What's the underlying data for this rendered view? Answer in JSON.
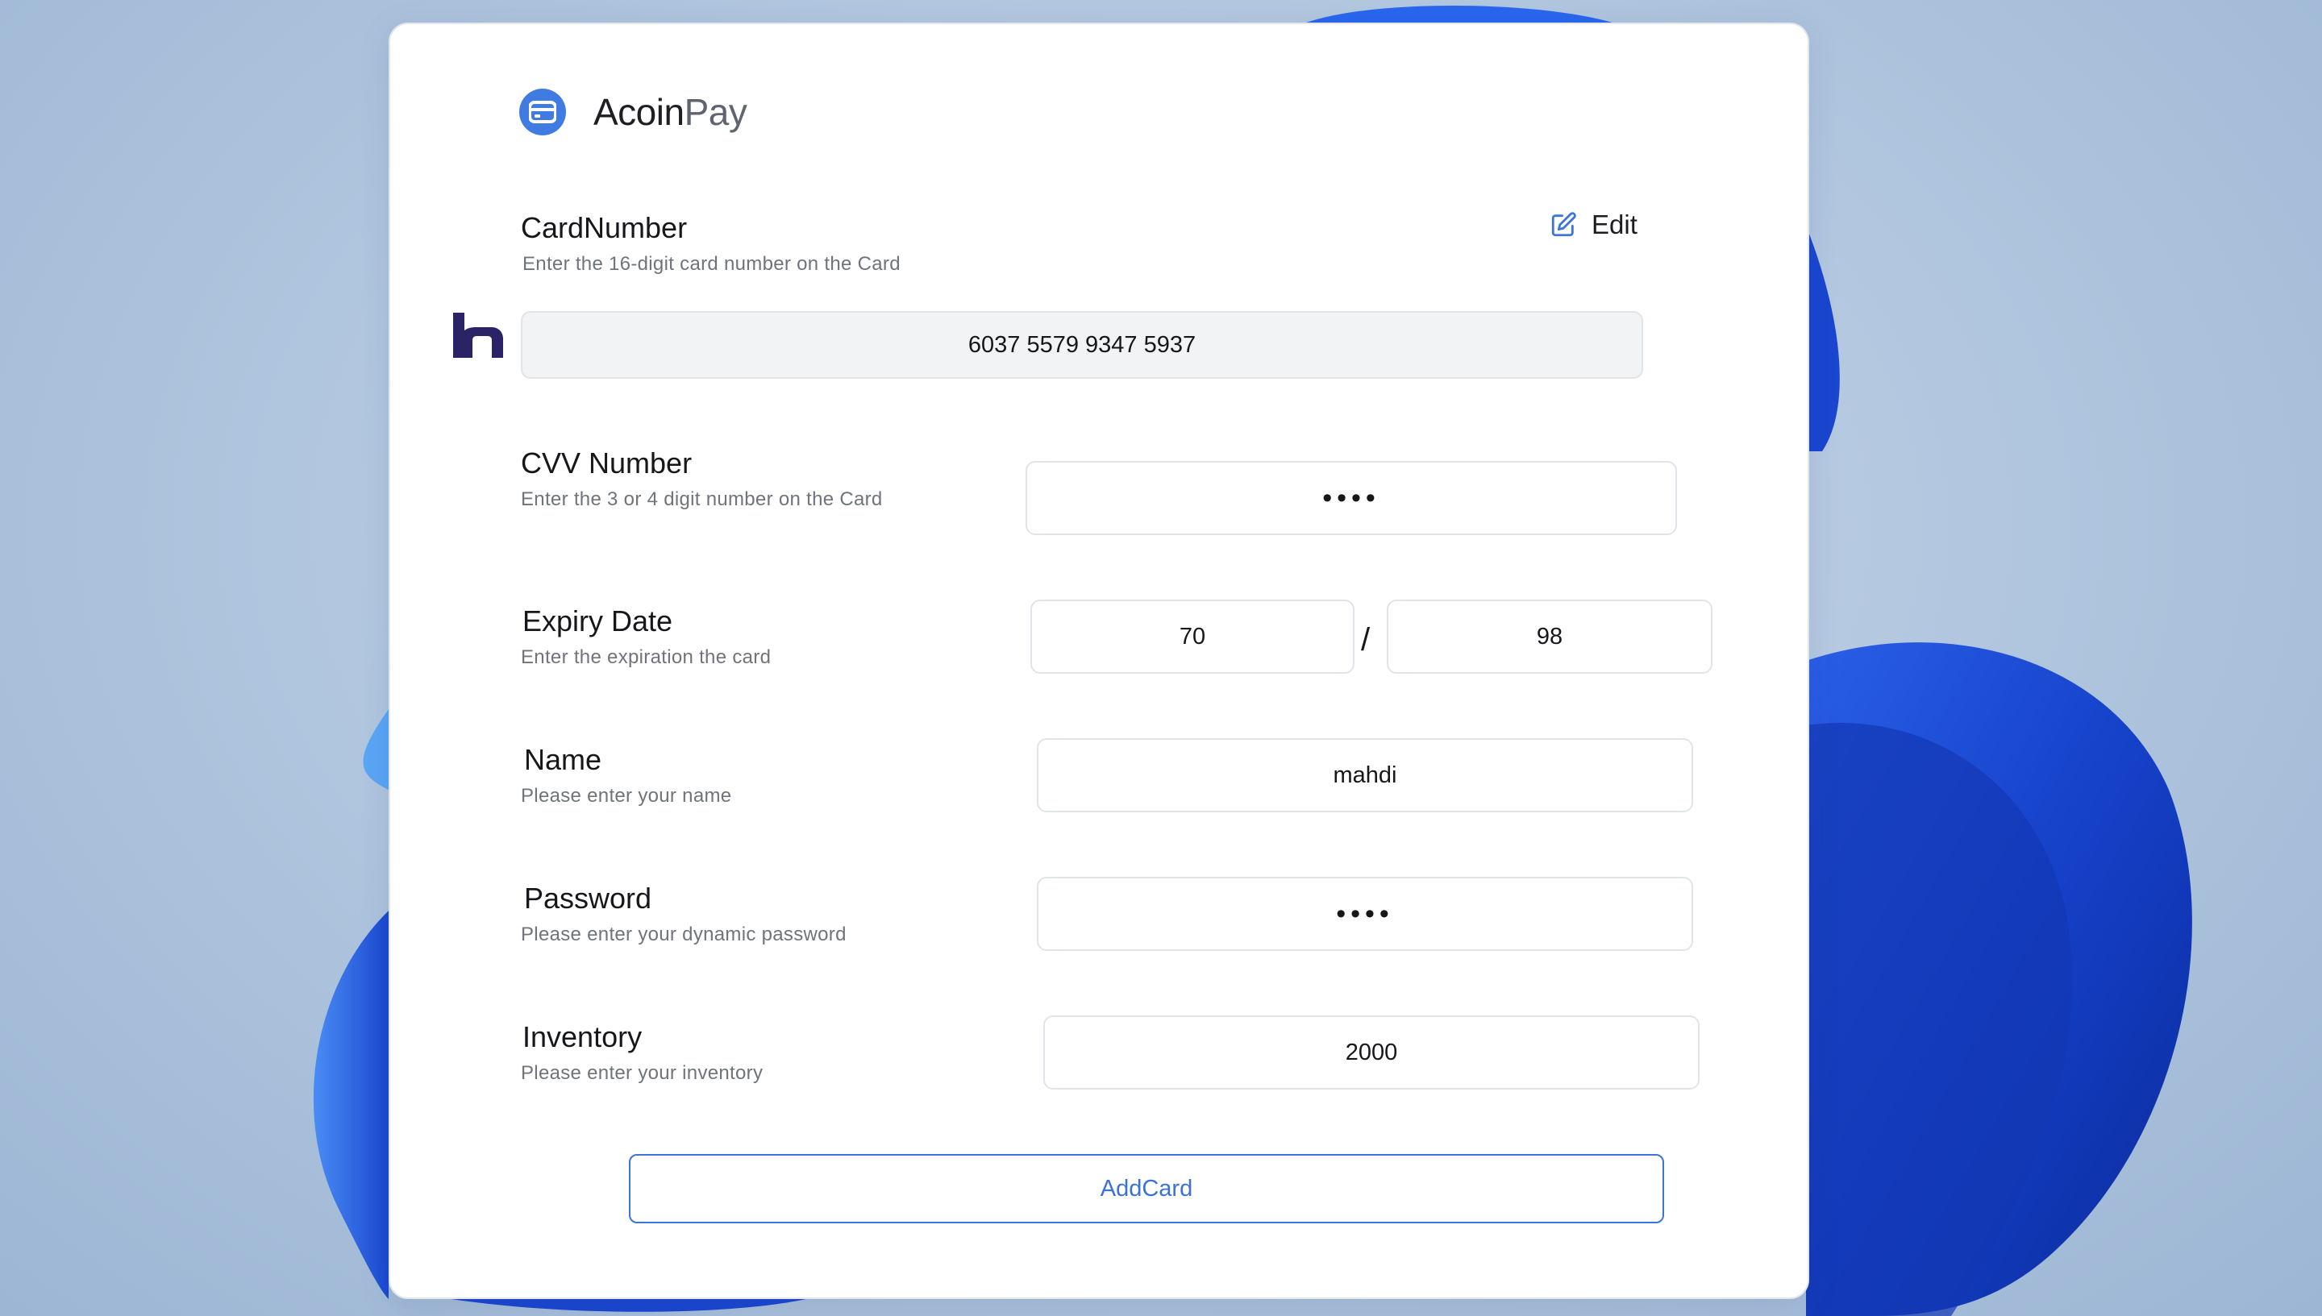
{
  "brand": {
    "name_part1": "Acoin",
    "name_part2": "Pay",
    "logo_icon": "credit-card-icon"
  },
  "card_number": {
    "title": "CardNumber",
    "hint": "Enter the 16-digit card number on the Card",
    "value": "6037 5579 9347 5937",
    "edit_label": "Edit",
    "bank_icon": "bank-logo-icon"
  },
  "cvv": {
    "title": "CVV Number",
    "hint": "Enter the 3 or 4 digit number on the Card",
    "value": "••••"
  },
  "expiry": {
    "title": "Expiry Date",
    "hint": "Enter the expiration the card",
    "month": "70",
    "separator": "/",
    "year": "98"
  },
  "name": {
    "title": "Name",
    "hint": "Please enter your name",
    "value": "mahdi"
  },
  "password": {
    "title": "Password",
    "hint": "Please enter your dynamic password",
    "value": "••••"
  },
  "inventory": {
    "title": "Inventory",
    "hint": "Please enter your inventory",
    "value": "2000"
  },
  "submit": {
    "label": "AddCard"
  },
  "colors": {
    "accent": "#3d74d9",
    "brand_logo": "#3f7be0",
    "bank_logo": "#2a2466"
  }
}
